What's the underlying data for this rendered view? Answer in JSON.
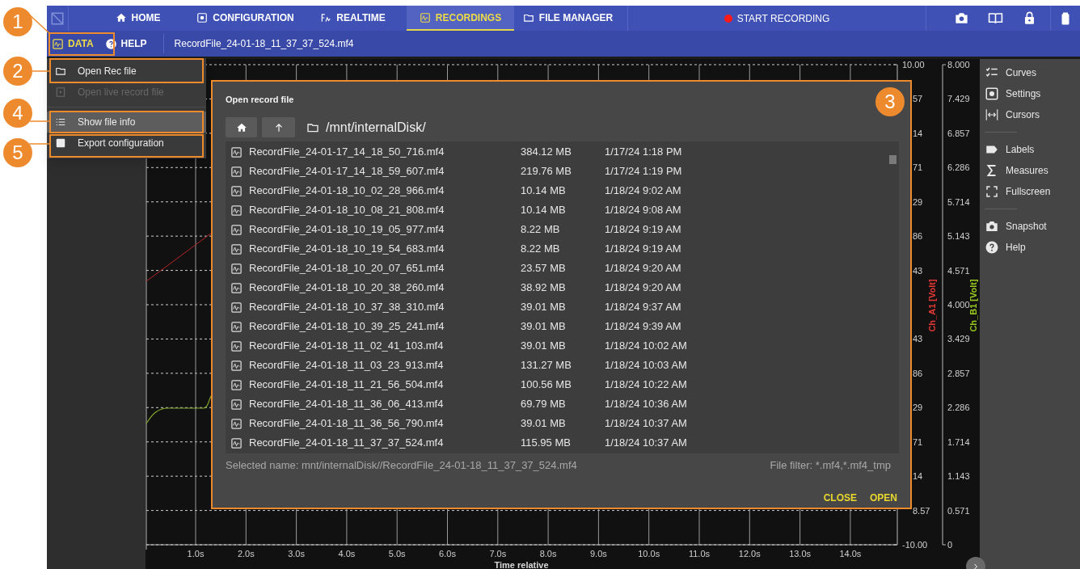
{
  "nav": {
    "tabs": [
      {
        "label": "HOME",
        "selected": false
      },
      {
        "label": "CONFIGURATION",
        "selected": false
      },
      {
        "label": "REALTIME",
        "selected": false
      },
      {
        "label": "RECORDINGS",
        "selected": true
      },
      {
        "label": "FILE MANAGER",
        "selected": false
      }
    ],
    "record_button": "START RECORDING"
  },
  "toolbar": {
    "menus": [
      {
        "label": "DATA",
        "selected": true
      },
      {
        "label": "HELP",
        "selected": false
      }
    ],
    "filename": "RecordFile_24-01-18_11_37_37_524.mf4"
  },
  "data_menu": {
    "items": [
      {
        "label": "Open Rec file",
        "disabled": false,
        "highlighted": false
      },
      {
        "label": "Open live record file",
        "disabled": true,
        "highlighted": false
      },
      {
        "label": "Show file info",
        "disabled": false,
        "highlighted": true
      },
      {
        "label": "Export configuration",
        "disabled": false,
        "highlighted": false
      }
    ]
  },
  "chart": {
    "x_ticks": [
      "1.0s",
      "2.0s",
      "3.0s",
      "4.0s",
      "5.0s",
      "6.0s",
      "7.0s",
      "8.0s",
      "9.0s",
      "10.0s",
      "11.0s",
      "12.0s",
      "13.0s",
      "14.0s"
    ],
    "x_title": "Time relative",
    "left_axis_labels": [
      "10.00",
      "57",
      "14",
      "71",
      "29",
      "86",
      "43",
      "43",
      "86",
      "29",
      "71",
      "14",
      "8.57",
      "-10.00"
    ],
    "right_axis_labels": [
      "8.000",
      "7.429",
      "6.857",
      "6.286",
      "5.714",
      "5.143",
      "4.571",
      "4.000",
      "3.429",
      "2.857",
      "2.286",
      "1.714",
      "1.143",
      "0.571",
      "0"
    ],
    "axis_titles": [
      {
        "label": "Ch_A1 [Volt]",
        "color": "#e53935"
      },
      {
        "label": "Ch_B1 [Volt]",
        "color": "#9bcc1f"
      }
    ]
  },
  "side_panel": {
    "groups": [
      {
        "items": [
          {
            "label": "Curves"
          },
          {
            "label": "Settings"
          },
          {
            "label": "Cursors"
          }
        ]
      },
      {
        "items": [
          {
            "label": "Labels"
          },
          {
            "label": "Measures"
          },
          {
            "label": "Fullscreen"
          }
        ]
      },
      {
        "items": [
          {
            "label": "Snapshot"
          },
          {
            "label": "Help"
          }
        ]
      }
    ]
  },
  "dialog": {
    "title": "Open record file",
    "path": "/mnt/internalDisk/",
    "files": [
      {
        "name": "RecordFile_24-01-17_14_18_50_716.mf4",
        "size": "384.12 MB",
        "date": "1/17/24 1:18 PM"
      },
      {
        "name": "RecordFile_24-01-17_14_18_59_607.mf4",
        "size": "219.76 MB",
        "date": "1/17/24 1:19 PM"
      },
      {
        "name": "RecordFile_24-01-18_10_02_28_966.mf4",
        "size": "10.14 MB",
        "date": "1/18/24 9:02 AM"
      },
      {
        "name": "RecordFile_24-01-18_10_08_21_808.mf4",
        "size": "10.14 MB",
        "date": "1/18/24 9:08 AM"
      },
      {
        "name": "RecordFile_24-01-18_10_19_05_977.mf4",
        "size": "8.22 MB",
        "date": "1/18/24 9:19 AM"
      },
      {
        "name": "RecordFile_24-01-18_10_19_54_683.mf4",
        "size": "8.22 MB",
        "date": "1/18/24 9:19 AM"
      },
      {
        "name": "RecordFile_24-01-18_10_20_07_651.mf4",
        "size": "23.57 MB",
        "date": "1/18/24 9:20 AM"
      },
      {
        "name": "RecordFile_24-01-18_10_20_38_260.mf4",
        "size": "38.92 MB",
        "date": "1/18/24 9:20 AM"
      },
      {
        "name": "RecordFile_24-01-18_10_37_38_310.mf4",
        "size": "39.01 MB",
        "date": "1/18/24 9:37 AM"
      },
      {
        "name": "RecordFile_24-01-18_10_39_25_241.mf4",
        "size": "39.01 MB",
        "date": "1/18/24 9:39 AM"
      },
      {
        "name": "RecordFile_24-01-18_11_02_41_103.mf4",
        "size": "39.01 MB",
        "date": "1/18/24 10:02 AM"
      },
      {
        "name": "RecordFile_24-01-18_11_03_23_913.mf4",
        "size": "131.27 MB",
        "date": "1/18/24 10:03 AM"
      },
      {
        "name": "RecordFile_24-01-18_11_21_56_504.mf4",
        "size": "100.56 MB",
        "date": "1/18/24 10:22 AM"
      },
      {
        "name": "RecordFile_24-01-18_11_36_06_413.mf4",
        "size": "69.79 MB",
        "date": "1/18/24 10:36 AM"
      },
      {
        "name": "RecordFile_24-01-18_11_36_56_790.mf4",
        "size": "39.01 MB",
        "date": "1/18/24 10:37 AM"
      },
      {
        "name": "RecordFile_24-01-18_11_37_37_524.mf4",
        "size": "115.95 MB",
        "date": "1/18/24 10:37 AM"
      }
    ],
    "selected_name": "Selected name: mnt/internalDisk//RecordFile_24-01-18_11_37_37_524.mf4",
    "file_filter": "File filter: *.mf4,*.mf4_tmp",
    "buttons": [
      "CLOSE",
      "OPEN"
    ]
  },
  "callouts": [
    {
      "number": "1"
    },
    {
      "number": "2"
    },
    {
      "number": "4"
    },
    {
      "number": "5"
    },
    {
      "number": "3"
    }
  ]
}
